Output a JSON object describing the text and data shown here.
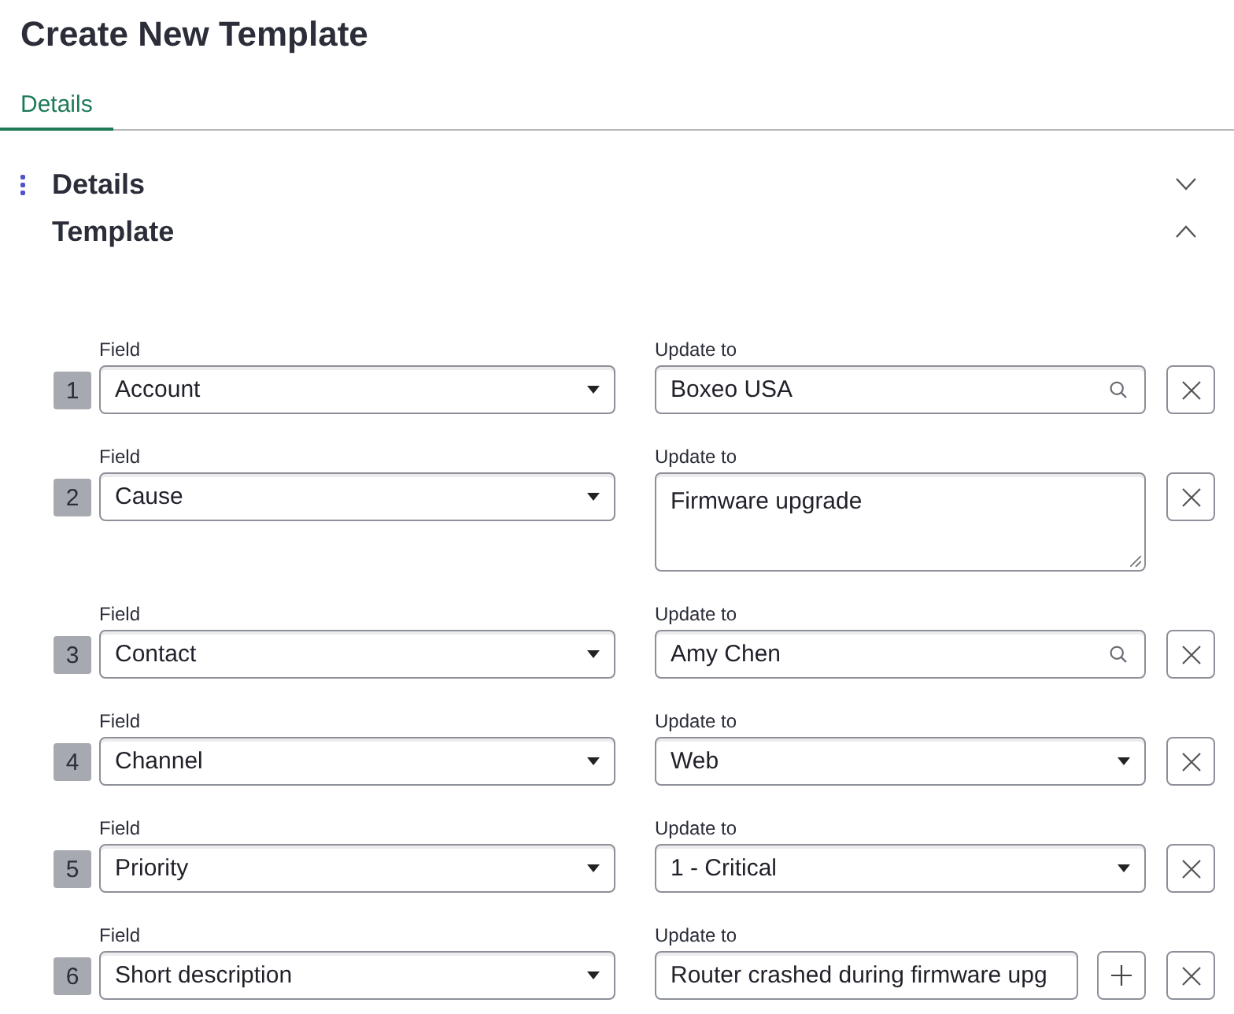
{
  "title": "Create New Template",
  "tabs": [
    {
      "label": "Details",
      "selected": true
    }
  ],
  "sections": [
    {
      "title": "Details",
      "expanded": false,
      "hovered": true
    },
    {
      "title": "Template",
      "expanded": true,
      "hovered": false,
      "rows": [
        {
          "number": "1",
          "field_label": "Field",
          "field": "Account",
          "value_label": "Update to",
          "value": "Boxeo USA",
          "kind": "lookup"
        },
        {
          "number": "2",
          "field_label": "Field",
          "field": "Cause",
          "value_label": "Update to",
          "value": "Firmware upgrade",
          "kind": "textarea"
        },
        {
          "number": "3",
          "field_label": "Field",
          "field": "Contact",
          "value_label": "Update to",
          "value": "Amy Chen",
          "kind": "lookup"
        },
        {
          "number": "4",
          "field_label": "Field",
          "field": "Channel",
          "value_label": "Update to",
          "value": "Web",
          "kind": "choice"
        },
        {
          "number": "5",
          "field_label": "Field",
          "field": "Priority",
          "value_label": "Update to",
          "value": "1 - Critical",
          "kind": "choice"
        },
        {
          "number": "6",
          "field_label": "Field",
          "field": "Short description",
          "value_label": "Update to",
          "value": "Router crashed during firmware upg",
          "kind": "string"
        }
      ]
    }
  ]
}
